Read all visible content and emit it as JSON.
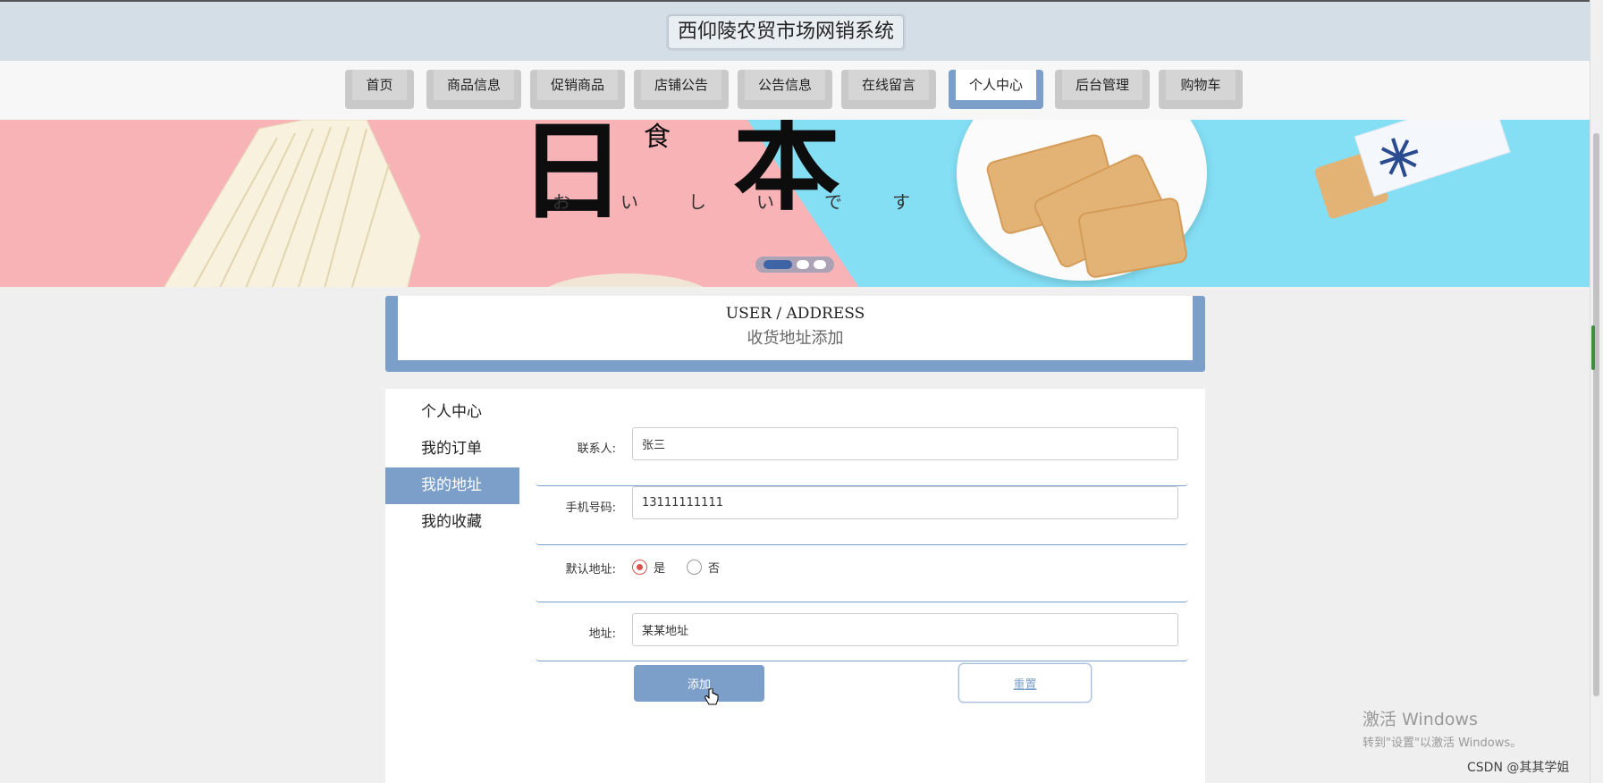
{
  "header": {
    "title": "西仰陵农贸市场网销系统"
  },
  "nav": {
    "items": [
      {
        "label": "首页"
      },
      {
        "label": "商品信息"
      },
      {
        "label": "促销商品"
      },
      {
        "label": "店铺公告"
      },
      {
        "label": "公告信息"
      },
      {
        "label": "在线留言"
      },
      {
        "label": "个人中心"
      },
      {
        "label": "后台管理"
      },
      {
        "label": "购物车"
      }
    ],
    "active_index": 6
  },
  "banner": {
    "kana": [
      "お",
      "い",
      "し",
      "い",
      "で",
      "す"
    ],
    "glyph_small": "食",
    "carousel": {
      "slides": 3,
      "active": 1
    }
  },
  "section": {
    "title_en": "USER / ADDRESS",
    "title_cn": "收货地址添加"
  },
  "sidebar": {
    "items": [
      {
        "label": "个人中心"
      },
      {
        "label": "我的订单"
      },
      {
        "label": "我的地址"
      },
      {
        "label": "我的收藏"
      }
    ],
    "active_index": 2
  },
  "form": {
    "contact": {
      "label": "联系人:",
      "value": "张三"
    },
    "phone": {
      "label": "手机号码:",
      "value": "13111111111"
    },
    "default": {
      "label": "默认地址:",
      "options": [
        "是",
        "否"
      ],
      "selected": "是"
    },
    "address": {
      "label": "地址:",
      "value": "某某地址"
    },
    "add_button": "添加",
    "reset_button": "重置"
  },
  "watermark": {
    "windows_title": "激活 Windows",
    "windows_sub": "转到\"设置\"以激活 Windows。",
    "csdn": "CSDN @其其学姐"
  },
  "colors": {
    "accent": "#7b9fc9",
    "header_bg": "#d4dee7",
    "radio_checked": "#d9534f"
  }
}
